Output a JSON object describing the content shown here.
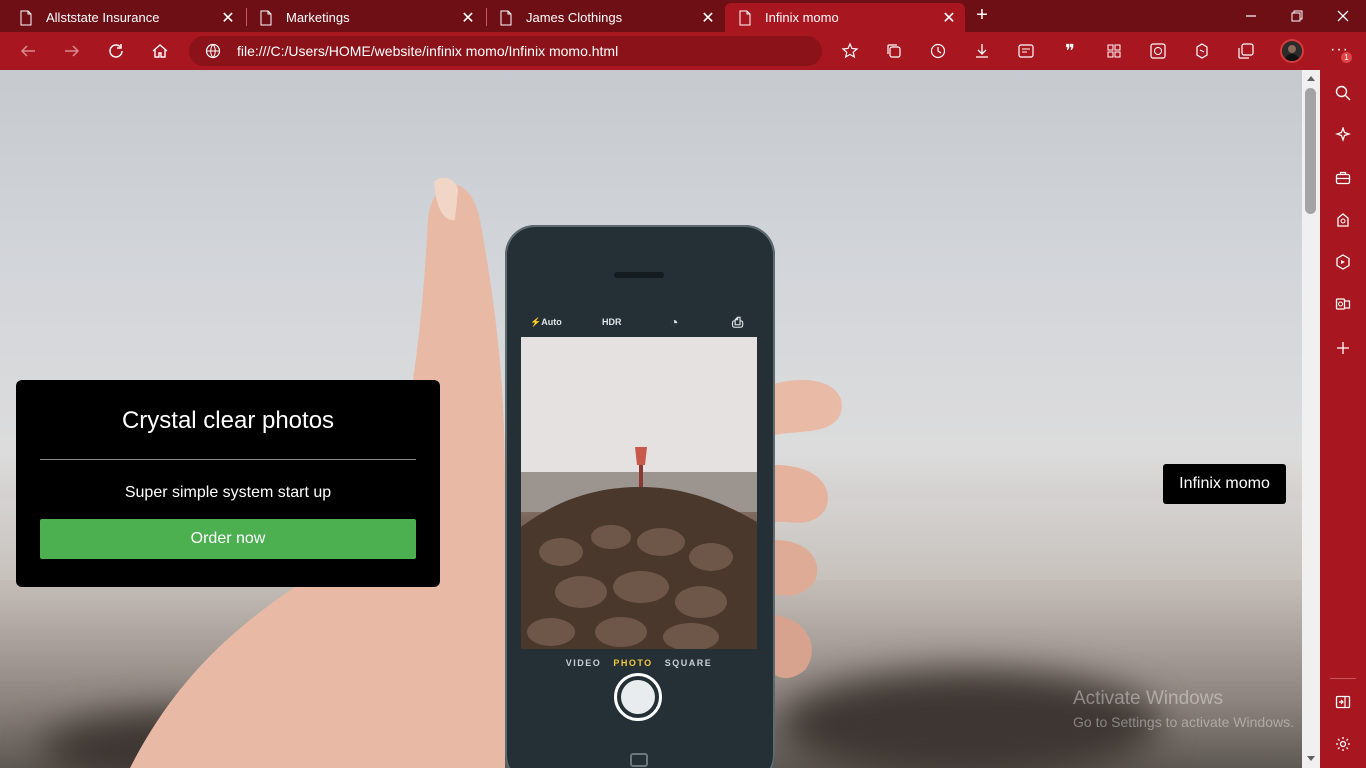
{
  "browser": {
    "tabs": [
      {
        "label": "Allststate Insurance",
        "active": false
      },
      {
        "label": "Marketings",
        "active": false
      },
      {
        "label": "James Clothings",
        "active": false
      },
      {
        "label": "Infinix momo",
        "active": true
      }
    ],
    "new_tab_icon": "plus-icon",
    "window_controls": [
      "minimize-icon",
      "restore-icon",
      "close-icon"
    ],
    "address": "file:///C:/Users/HOME/website/infinix momo/Infinix momo.html",
    "notification_count": "1",
    "accent_color": "#a8161f"
  },
  "page": {
    "card": {
      "title": "Crystal clear photos",
      "subtitle": "Super simple system start up",
      "button": "Order now"
    },
    "brand_label": "Infinix momo",
    "phone_ui": {
      "top": [
        "Auto",
        "HDR"
      ],
      "modes": [
        "VIDEO",
        "PHOTO",
        "SQUARE"
      ]
    }
  },
  "os": {
    "watermark_title": "Activate Windows",
    "watermark_text": "Go to Settings to activate Windows."
  }
}
